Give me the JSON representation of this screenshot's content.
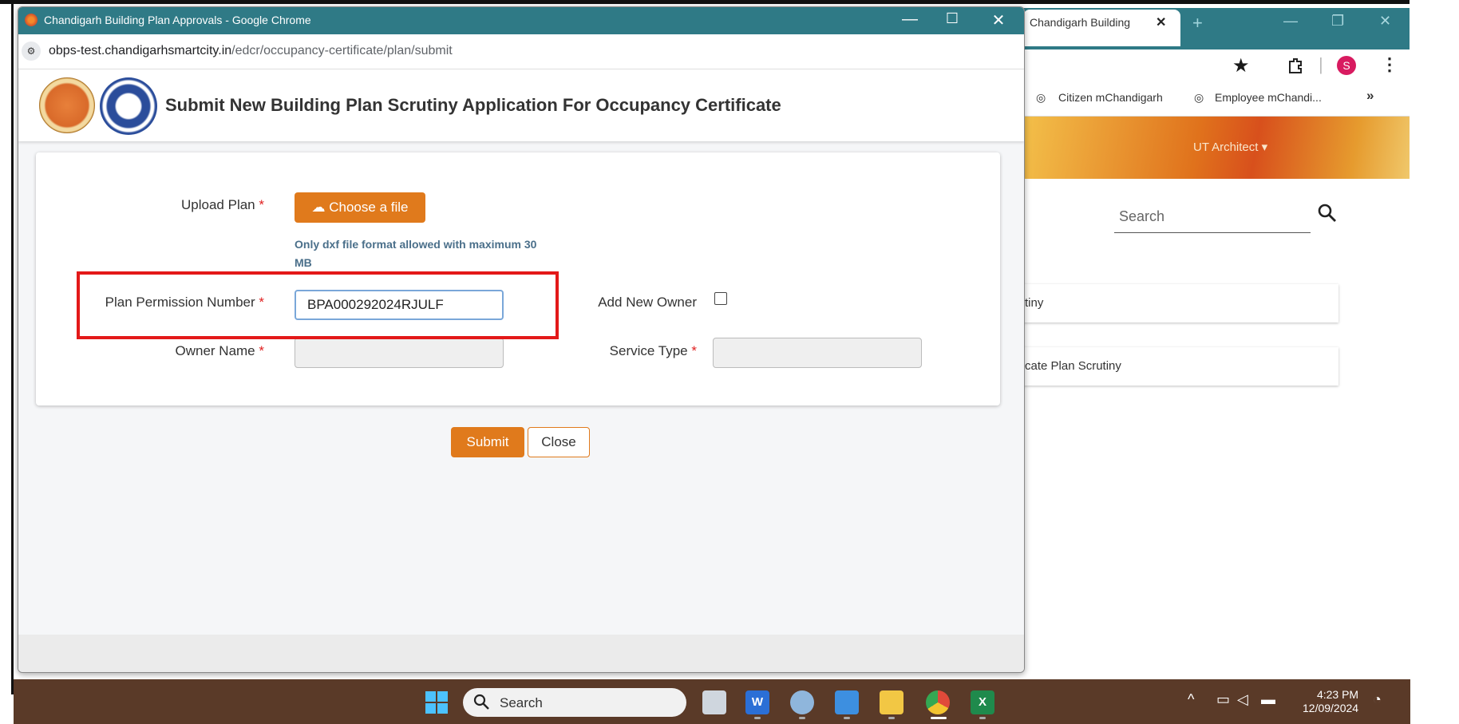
{
  "popup": {
    "window_title": "Chandigarh Building Plan Approvals - Google Chrome",
    "minimize": "—",
    "maximize": "☐",
    "close": "✕",
    "url_host": "obps-test.chandigarhsmartcity.in",
    "url_path": "/edcr/occupancy-certificate/plan/submit"
  },
  "header": {
    "title": "Submit New Building Plan Scrutiny Application For Occupancy Certificate"
  },
  "form": {
    "upload_label": "Upload Plan",
    "required_mark": "*",
    "choose_file_label": "Choose a file",
    "hint_line1": "Only dxf file format allowed with maximum 30",
    "hint_line2": "MB",
    "plan_permission_label": "Plan Permission Number",
    "plan_permission_value": "BPA000292024RJULF",
    "add_new_owner_label": "Add New Owner",
    "add_new_owner_checked": false,
    "owner_name_label": "Owner Name",
    "owner_name_value": "",
    "service_type_label": "Service Type",
    "service_type_value": ""
  },
  "actions": {
    "submit_label": "Submit",
    "close_label": "Close"
  },
  "background_window": {
    "tab_title": "Chandigarh Building",
    "tab_close": "✕",
    "new_tab": "+",
    "bookmarks": [
      "Citizen mChandigarh",
      "Employee mChandi..."
    ],
    "bookmarks_more": "»",
    "profile_initial": "S",
    "user_menu": "UT Architect ▾",
    "search_label": "Search",
    "card1_text": "tiny",
    "card2_text": "cate Plan Scrutiny"
  },
  "taskbar": {
    "search_label": "Search",
    "time": "4:23 PM",
    "date": "12/09/2024"
  },
  "colors": {
    "accent": "#e07a1c",
    "titlebar": "#2f7a86",
    "highlight": "#e31919",
    "taskbar": "#5a3a28"
  }
}
